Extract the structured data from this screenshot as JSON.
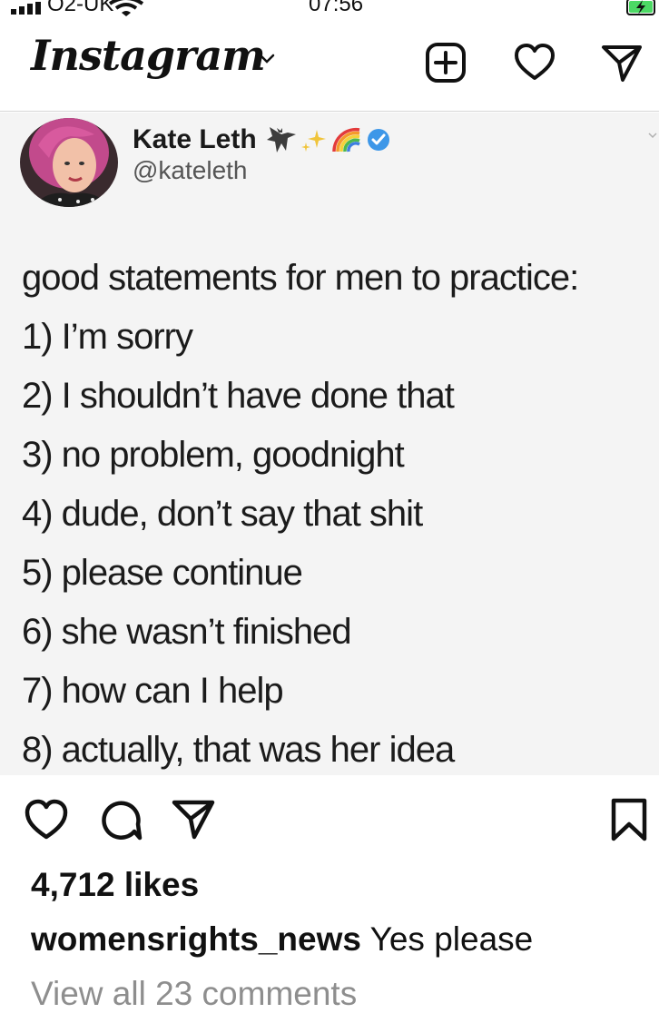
{
  "status_bar": {
    "carrier": "O2-UK",
    "time": "07:56"
  },
  "header": {
    "logo_text": "Instagram"
  },
  "post": {
    "tweet": {
      "display_name": "Kate Leth",
      "handle": "@kateleth",
      "lines": [
        "good statements for men to practice:",
        "1) I’m sorry",
        "2) I shouldn’t have done that",
        "3) no problem, goodnight",
        "4) dude, don’t say that shit",
        "5) please continue",
        "6) she wasn’t finished",
        "7) how can I help",
        "8) actually, that was her idea"
      ]
    },
    "likes": "4,712 likes",
    "caption_user": "womensrights_news",
    "caption_text": "Yes please",
    "view_comments": "View all 23 comments"
  },
  "colors": {
    "verified": "#3d97e8",
    "muted_text": "#8e8e8e",
    "battery": "#4cd964"
  },
  "icons": {
    "status": [
      "signal-icon",
      "wifi-icon",
      "battery-icon"
    ],
    "header": [
      "chevron-down-icon",
      "add-post-icon",
      "heart-icon",
      "direct-message-icon"
    ],
    "actions": [
      "like-icon",
      "comment-icon",
      "share-icon",
      "save-icon"
    ]
  }
}
